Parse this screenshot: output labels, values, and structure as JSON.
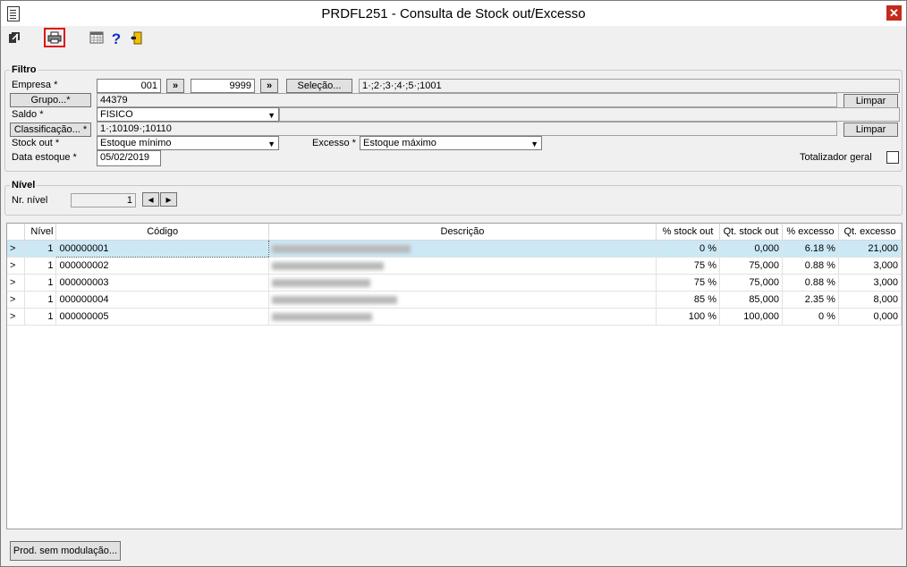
{
  "window": {
    "title": "PRDFL251 - Consulta de Stock out/Excesso",
    "close_glyph": "✕"
  },
  "toolbar": {
    "items": [
      "exit-icon",
      "print-icon",
      "calendar-icon",
      "help-icon",
      "door-exit-icon"
    ],
    "help_glyph": "?"
  },
  "filtro": {
    "title": "Filtro",
    "empresa_label": "Empresa *",
    "empresa_from": "001",
    "empresa_to": "9999",
    "range_btn": "»",
    "selecao_btn": "Seleção...",
    "selecao_value": "1·;2·;3·;4·;5·;1001",
    "grupo_btn": "Grupo...*",
    "grupo_value": "44379",
    "limpar_btn": "Limpar",
    "saldo_label": "Saldo *",
    "saldo_value": "FISICO",
    "classificacao_btn": "Classificação... *",
    "classificacao_value": "1·;10109·;10110",
    "stockout_label": "Stock out *",
    "stockout_value": "Estoque mínimo",
    "excesso_label": "Excesso *",
    "excesso_value": "Estoque máximo",
    "data_label": "Data estoque *",
    "data_value": "05/02/2019",
    "totalizador_label": "Totalizador geral",
    "totalizador_checked": false
  },
  "nivel": {
    "title": "Nível",
    "nr_label": "Nr. nível",
    "nr_value": "1",
    "prev_glyph": "◂",
    "next_glyph": "▸"
  },
  "table": {
    "columns": [
      "",
      "Nível",
      "Código",
      "Descrição",
      "% stock out",
      "Qt. stock out",
      "% excesso",
      "Qt. excesso"
    ],
    "rows": [
      {
        "marker": ">",
        "nivel": "1",
        "codigo": "000000001",
        "pct_stock_out": "0 %",
        "qt_stock_out": "0,000",
        "pct_excesso": "6.18 %",
        "qt_excesso": "21,000"
      },
      {
        "marker": ">",
        "nivel": "1",
        "codigo": "000000002",
        "pct_stock_out": "75 %",
        "qt_stock_out": "75,000",
        "pct_excesso": "0.88 %",
        "qt_excesso": "3,000"
      },
      {
        "marker": ">",
        "nivel": "1",
        "codigo": "000000003",
        "pct_stock_out": "75 %",
        "qt_stock_out": "75,000",
        "pct_excesso": "0.88 %",
        "qt_excesso": "3,000"
      },
      {
        "marker": ">",
        "nivel": "1",
        "codigo": "000000004",
        "pct_stock_out": "85 %",
        "qt_stock_out": "85,000",
        "pct_excesso": "2.35 %",
        "qt_excesso": "8,000"
      },
      {
        "marker": ">",
        "nivel": "1",
        "codigo": "000000005",
        "pct_stock_out": "100 %",
        "qt_stock_out": "100,000",
        "pct_excesso": "0 %",
        "qt_excesso": "0,000"
      }
    ]
  },
  "footer": {
    "prod_btn": "Prod. sem modulação..."
  }
}
